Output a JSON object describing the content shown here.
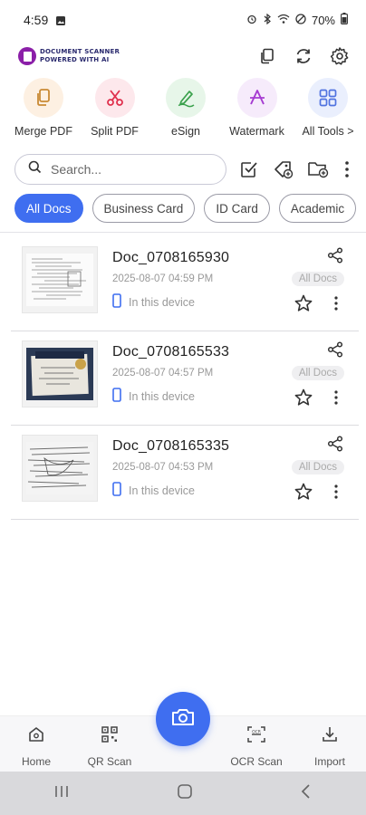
{
  "status_bar": {
    "time": "4:59",
    "battery": "70%"
  },
  "header": {
    "logo_line1": "DOCUMENT SCANNER",
    "logo_line2": "POWERED WITH AI"
  },
  "tools": [
    {
      "label": "Merge PDF",
      "icon": "merge-icon",
      "bg": "#fdf0e2",
      "color": "#c98a35"
    },
    {
      "label": "Split PDF",
      "icon": "scissors-icon",
      "bg": "#fde8ec",
      "color": "#e0304d"
    },
    {
      "label": "eSign",
      "icon": "pen-icon",
      "bg": "#e7f6e9",
      "color": "#3aa14c"
    },
    {
      "label": "Watermark",
      "icon": "watermark-icon",
      "bg": "#f6ebfb",
      "color": "#a53ad1"
    },
    {
      "label": "All Tools >",
      "icon": "grid-icon",
      "bg": "#eaeffd",
      "color": "#5073e0"
    }
  ],
  "search": {
    "placeholder": "Search..."
  },
  "filters": [
    "All Docs",
    "Business Card",
    "ID Card",
    "Academic"
  ],
  "documents": [
    {
      "name": "Doc_0708165930",
      "date": "2025-08-07  04:59 PM",
      "location": "In this device",
      "category": "All Docs"
    },
    {
      "name": "Doc_0708165533",
      "date": "2025-08-07  04:57 PM",
      "location": "In this device",
      "category": "All Docs"
    },
    {
      "name": "Doc_0708165335",
      "date": "2025-08-07  04:53 PM",
      "location": "In this device",
      "category": "All Docs"
    }
  ],
  "bottom_nav": {
    "home": "Home",
    "qr": "QR Scan",
    "ocr": "OCR Scan",
    "import": "Import"
  },
  "colors": {
    "accent": "#3f6ef0"
  }
}
